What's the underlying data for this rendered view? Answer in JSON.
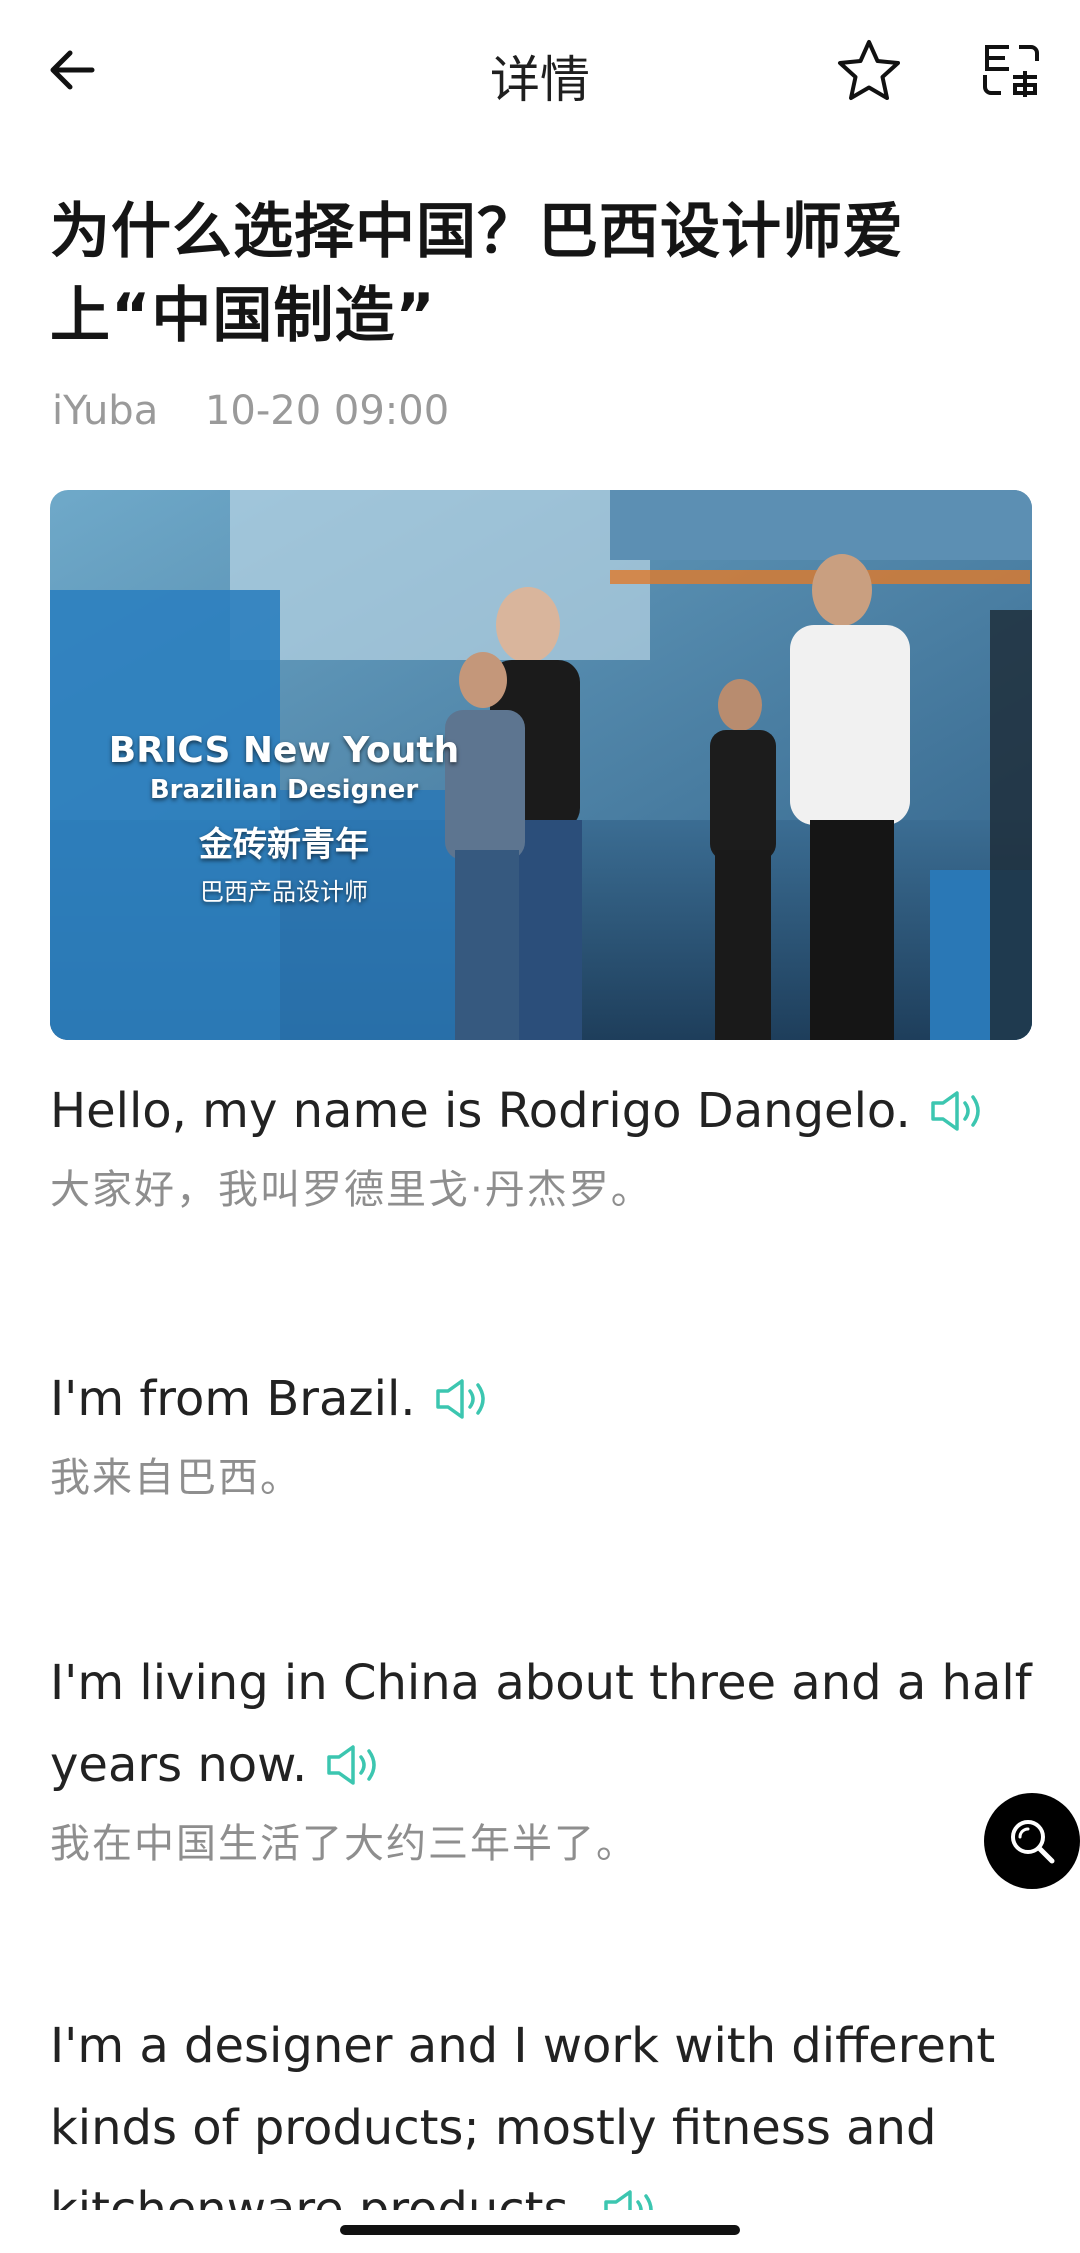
{
  "header": {
    "title": "详情",
    "back_icon": "arrow-left-icon",
    "favorite_icon": "star-outline-icon",
    "translate_icon": "translate-icon"
  },
  "article": {
    "title": "为什么选择中国？巴西设计师爱上“中国制造”",
    "source": "iYuba",
    "datetime": "10-20 09:00",
    "hero_image": {
      "caption_en_line1": "BRICS New Youth",
      "caption_en_line2": "Brazilian Designer",
      "caption_zh_line1": "金砖新青年",
      "caption_zh_line2": "巴西产品设计师"
    }
  },
  "sentences": [
    {
      "en": "Hello, my name is Rodrigo Dangelo.",
      "zh": "大家好，我叫罗德里戈·丹杰罗。"
    },
    {
      "en": "I'm from Brazil.",
      "zh": "我来自巴西。"
    },
    {
      "en": "I'm living in China about three and a half years now.",
      "zh": "我在中国生活了大约三年半了。"
    },
    {
      "en": "I'm a designer and I work with different kinds of products; mostly fitness and kitchenware products.",
      "zh": ""
    }
  ],
  "fab": {
    "icon": "search-icon"
  },
  "colors": {
    "accent": "#3cc6b0",
    "text": "#222222",
    "secondary": "#8e8e8e"
  }
}
